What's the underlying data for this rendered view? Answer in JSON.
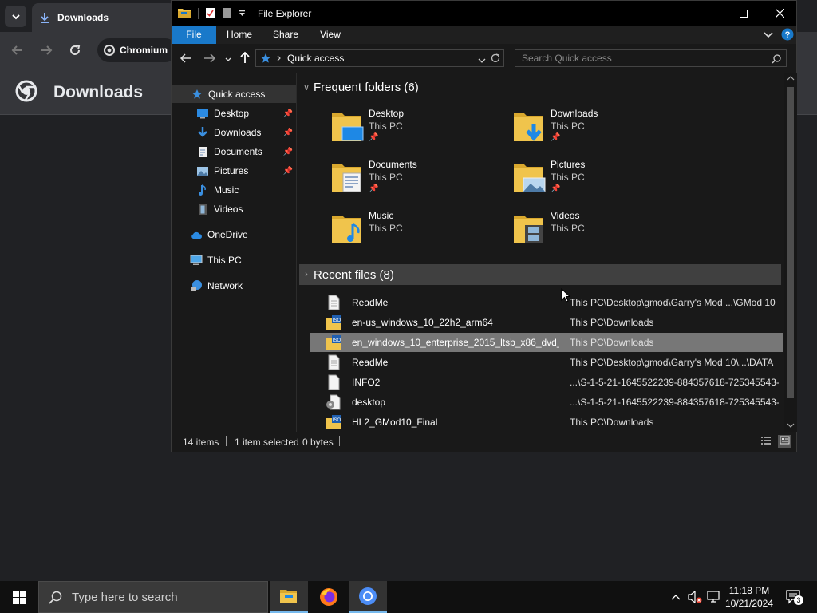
{
  "chromium": {
    "tab_title": "Downloads",
    "omnibox_label": "Chromium",
    "page_title": "Downloads"
  },
  "explorer": {
    "title": "File Explorer",
    "ribbon_tabs": [
      "File",
      "Home",
      "Share",
      "View"
    ],
    "address_location": "Quick access",
    "search_placeholder": "Search Quick access",
    "nav": {
      "quick_access": "Quick access",
      "pinned": [
        {
          "label": "Desktop",
          "icon": "desktop-icon",
          "pinned": true
        },
        {
          "label": "Downloads",
          "icon": "download-arrow-icon",
          "pinned": true
        },
        {
          "label": "Documents",
          "icon": "document-icon",
          "pinned": true
        },
        {
          "label": "Pictures",
          "icon": "picture-icon",
          "pinned": true
        },
        {
          "label": "Music",
          "icon": "music-note-icon",
          "pinned": false
        },
        {
          "label": "Videos",
          "icon": "film-icon",
          "pinned": false
        }
      ],
      "onedrive": "OneDrive",
      "this_pc": "This PC",
      "network": "Network"
    },
    "frequent_header": "Frequent folders (6)",
    "frequent": [
      {
        "name": "Desktop",
        "sub": "This PC",
        "pinned": true
      },
      {
        "name": "Downloads",
        "sub": "This PC",
        "pinned": true
      },
      {
        "name": "Documents",
        "sub": "This PC",
        "pinned": true
      },
      {
        "name": "Pictures",
        "sub": "This PC",
        "pinned": true
      },
      {
        "name": "Music",
        "sub": "This PC",
        "pinned": false
      },
      {
        "name": "Videos",
        "sub": "This PC",
        "pinned": false
      }
    ],
    "recent_header": "Recent files (8)",
    "recent": [
      {
        "name": "ReadMe",
        "location": "This PC\\Desktop\\gmod\\Garry's Mod ...\\GMod 10",
        "icon": "text-file-icon"
      },
      {
        "name": "en-us_windows_10_22h2_arm64",
        "location": "This PC\\Downloads",
        "icon": "iso-file-icon"
      },
      {
        "name": "en_windows_10_enterprise_2015_ltsb_x86_dvd_...",
        "location": "This PC\\Downloads",
        "icon": "iso-file-icon",
        "selected": true
      },
      {
        "name": "ReadMe",
        "location": "This PC\\Desktop\\gmod\\Garry's Mod 10\\...\\DATA",
        "icon": "text-file-icon"
      },
      {
        "name": "INFO2",
        "location": "...\\S-1-5-21-1645522239-884357618-725345543-...",
        "icon": "blank-file-icon"
      },
      {
        "name": "desktop",
        "location": "...\\S-1-5-21-1645522239-884357618-725345543-...",
        "icon": "settings-file-icon"
      },
      {
        "name": "HL2_GMod10_Final",
        "location": "This PC\\Downloads",
        "icon": "iso-file-icon"
      }
    ],
    "status": {
      "items": "14 items",
      "selected": "1 item selected",
      "size": "0 bytes"
    }
  },
  "taskbar": {
    "search_placeholder": "Type here to search",
    "time": "11:18 PM",
    "date": "10/21/2024",
    "notification_count": "3"
  },
  "colors": {
    "accent": "#1979ca",
    "folder": "#f0c44c",
    "folder_dark": "#d9a82e"
  }
}
